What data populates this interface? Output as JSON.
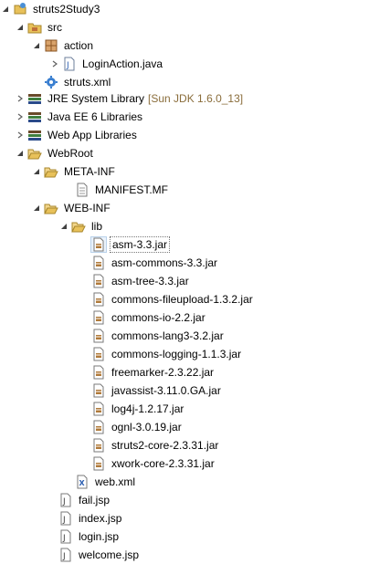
{
  "tree": {
    "project": "struts2Study3",
    "src": {
      "folder": "src",
      "package": "action",
      "action_file": "LoginAction.java",
      "struts_xml": "struts.xml"
    },
    "libraries": [
      {
        "label": "JRE System Library",
        "decoration": "[Sun JDK 1.6.0_13]"
      },
      {
        "label": "Java EE 6 Libraries"
      },
      {
        "label": "Web App Libraries"
      }
    ],
    "webroot": {
      "label": "WebRoot",
      "meta_inf": "META-INF",
      "manifest": "MANIFEST.MF",
      "web_inf": "WEB-INF",
      "lib": "lib",
      "jars": [
        "asm-3.3.jar",
        "asm-commons-3.3.jar",
        "asm-tree-3.3.jar",
        "commons-fileupload-1.3.2.jar",
        "commons-io-2.2.jar",
        "commons-lang3-3.2.jar",
        "commons-logging-1.1.3.jar",
        "freemarker-2.3.22.jar",
        "javassist-3.11.0.GA.jar",
        "log4j-1.2.17.jar",
        "ognl-3.0.19.jar",
        "struts2-core-2.3.31.jar",
        "xwork-core-2.3.31.jar"
      ],
      "web_xml": "web.xml",
      "jsps": [
        "fail.jsp",
        "index.jsp",
        "login.jsp",
        "welcome.jsp"
      ]
    }
  },
  "colors": {
    "folder": "#e8c15a",
    "decoration": "#8a6d3b",
    "package": "#c0703a"
  }
}
